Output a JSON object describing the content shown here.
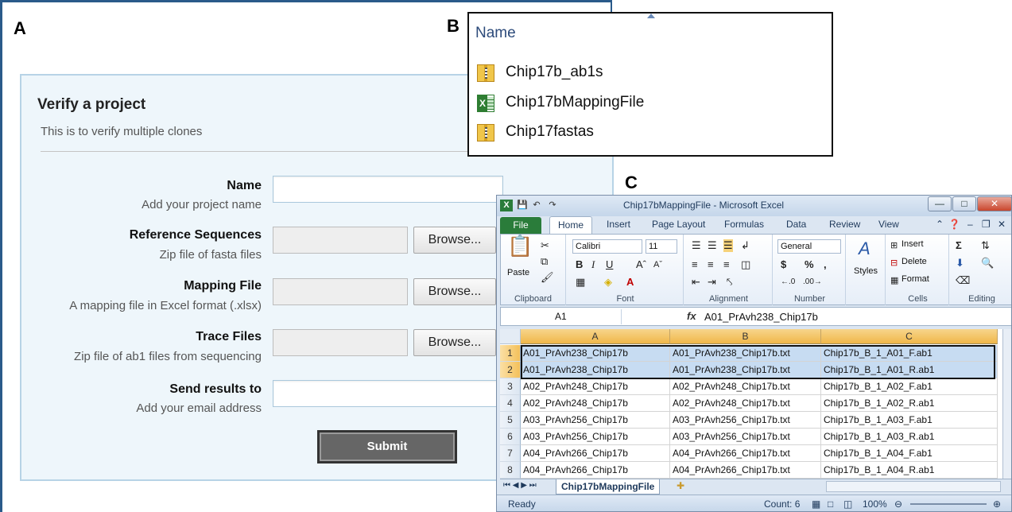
{
  "panels": {
    "a": "A",
    "b": "B",
    "c": "C"
  },
  "form": {
    "title": "Verify a project",
    "subtitle": "This is to verify multiple clones",
    "fields": [
      {
        "label": "Name",
        "help": "Add your project name",
        "type": "text",
        "value": ""
      },
      {
        "label": "Reference Sequences",
        "help": "Zip file of fasta files",
        "type": "file",
        "button": "Browse...",
        "value": ""
      },
      {
        "label": "Mapping File",
        "help": "A mapping file in Excel format (.xlsx)",
        "type": "file",
        "button": "Browse...",
        "value": ""
      },
      {
        "label": "Trace Files",
        "help": "Zip file of ab1 files from sequencing",
        "type": "file",
        "button": "Browse...",
        "value": ""
      },
      {
        "label": "Send results to",
        "help": "Add your email address",
        "type": "text",
        "value": ""
      }
    ],
    "submit_label": "Submit",
    "colors": {
      "panel_bg": "#eef6fb",
      "panel_border": "#b7d3e6",
      "submit_bg": "#666666"
    }
  },
  "explorer": {
    "column_header": "Name",
    "items": [
      {
        "name": "Chip17b_ab1s",
        "icon": "zip-folder-icon"
      },
      {
        "name": "Chip17bMappingFile",
        "icon": "excel-file-icon"
      },
      {
        "name": "Chip17fastas",
        "icon": "zip-folder-icon"
      }
    ]
  },
  "excel": {
    "window_title": "Chip17bMappingFile - Microsoft Excel",
    "tabs": [
      "File",
      "Home",
      "Insert",
      "Page Layout",
      "Formulas",
      "Data",
      "Review",
      "View"
    ],
    "ribbon": {
      "clipboard": {
        "label": "Clipboard",
        "paste": "Paste"
      },
      "font": {
        "label": "Font",
        "name": "Calibri",
        "size": "11"
      },
      "alignment": {
        "label": "Alignment"
      },
      "number": {
        "label": "Number",
        "format": "General"
      },
      "styles": {
        "label": "Styles"
      },
      "cells": {
        "label": "Cells",
        "insert": "Insert",
        "delete": "Delete",
        "format": "Format"
      },
      "editing": {
        "label": "Editing"
      }
    },
    "name_box": "A1",
    "formula_value": "A01_PrAvh238_Chip17b",
    "columns": [
      "A",
      "B",
      "C"
    ],
    "rows": [
      {
        "num": "1",
        "cells": [
          "A01_PrAvh238_Chip17b",
          "A01_PrAvh238_Chip17b.txt",
          "Chip17b_B_1_A01_F.ab1"
        ],
        "selected": true
      },
      {
        "num": "2",
        "cells": [
          "A01_PrAvh238_Chip17b",
          "A01_PrAvh238_Chip17b.txt",
          "Chip17b_B_1_A01_R.ab1"
        ],
        "selected": true
      },
      {
        "num": "3",
        "cells": [
          "A02_PrAvh248_Chip17b",
          "A02_PrAvh248_Chip17b.txt",
          "Chip17b_B_1_A02_F.ab1"
        ],
        "selected": false
      },
      {
        "num": "4",
        "cells": [
          "A02_PrAvh248_Chip17b",
          "A02_PrAvh248_Chip17b.txt",
          "Chip17b_B_1_A02_R.ab1"
        ],
        "selected": false
      },
      {
        "num": "5",
        "cells": [
          "A03_PrAvh256_Chip17b",
          "A03_PrAvh256_Chip17b.txt",
          "Chip17b_B_1_A03_F.ab1"
        ],
        "selected": false
      },
      {
        "num": "6",
        "cells": [
          "A03_PrAvh256_Chip17b",
          "A03_PrAvh256_Chip17b.txt",
          "Chip17b_B_1_A03_R.ab1"
        ],
        "selected": false
      },
      {
        "num": "7",
        "cells": [
          "A04_PrAvh266_Chip17b",
          "A04_PrAvh266_Chip17b.txt",
          "Chip17b_B_1_A04_F.ab1"
        ],
        "selected": false
      },
      {
        "num": "8",
        "cells": [
          "A04_PrAvh266_Chip17b",
          "A04_PrAvh266_Chip17b.txt",
          "Chip17b_B_1_A04_R.ab1"
        ],
        "selected": false
      }
    ],
    "sheet_tab": "Chip17bMappingFile",
    "status": {
      "ready": "Ready",
      "count": "Count: 6",
      "zoom": "100%"
    },
    "colors": {
      "file_tab": "#2a7c3a",
      "selection": "#c7dcf2",
      "col_header": "#f0b749"
    }
  }
}
